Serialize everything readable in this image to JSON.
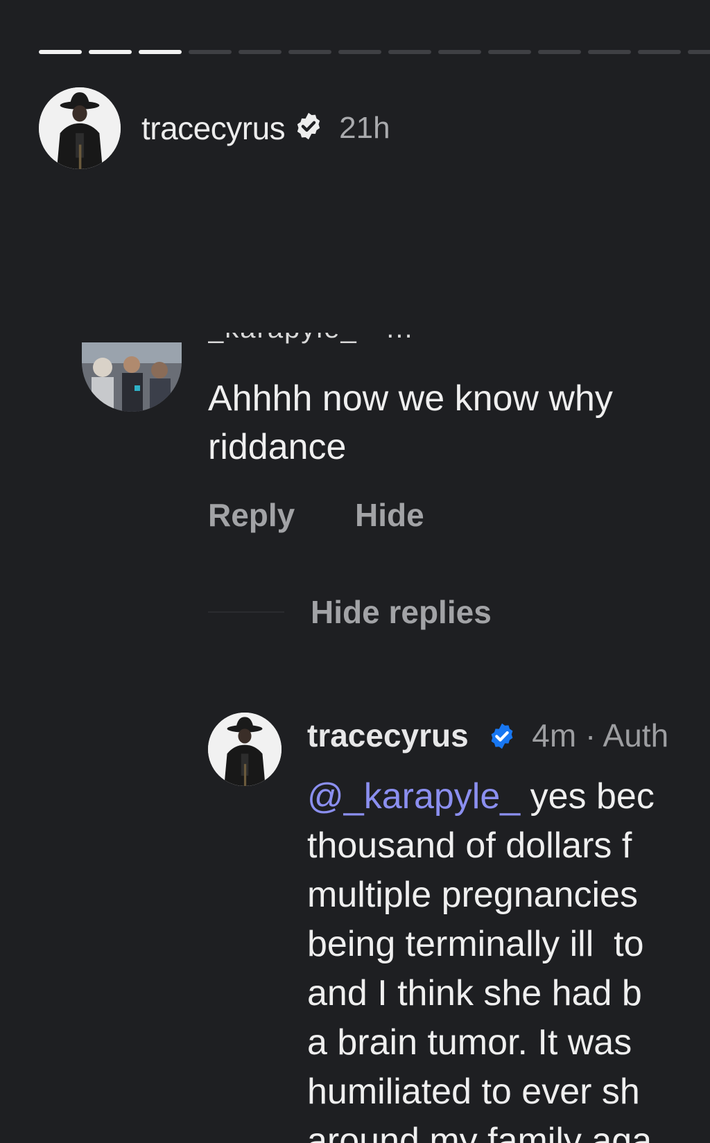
{
  "story": {
    "progress": {
      "total_segments": 14,
      "completed_segments": 3
    },
    "username": "tracecyrus",
    "time": "21h"
  },
  "comment": {
    "username_partial": "_karapyle_ · ...",
    "text_line1": "Ahhhh now we know why",
    "text_line2": "riddance",
    "reply_label": "Reply",
    "hide_label": "Hide"
  },
  "hide_replies_label": "Hide replies",
  "reply": {
    "username": "tracecyrus",
    "meta": "4m · Auth",
    "mention": "@_karapyle_",
    "line1_rest": " yes bec",
    "line2": "thousand of dollars f",
    "line3": "multiple pregnancies",
    "line4": "being terminally ill  to",
    "line5": "and I think she had b",
    "line6": "a brain tumor. It was",
    "line7": "humiliated to ever sh",
    "line8": "around my family aga"
  },
  "colors": {
    "background": "#1e1f22",
    "verified_blue": "#1877f2",
    "mention": "#8b8ff0",
    "secondary_text": "#a2a3a6"
  }
}
